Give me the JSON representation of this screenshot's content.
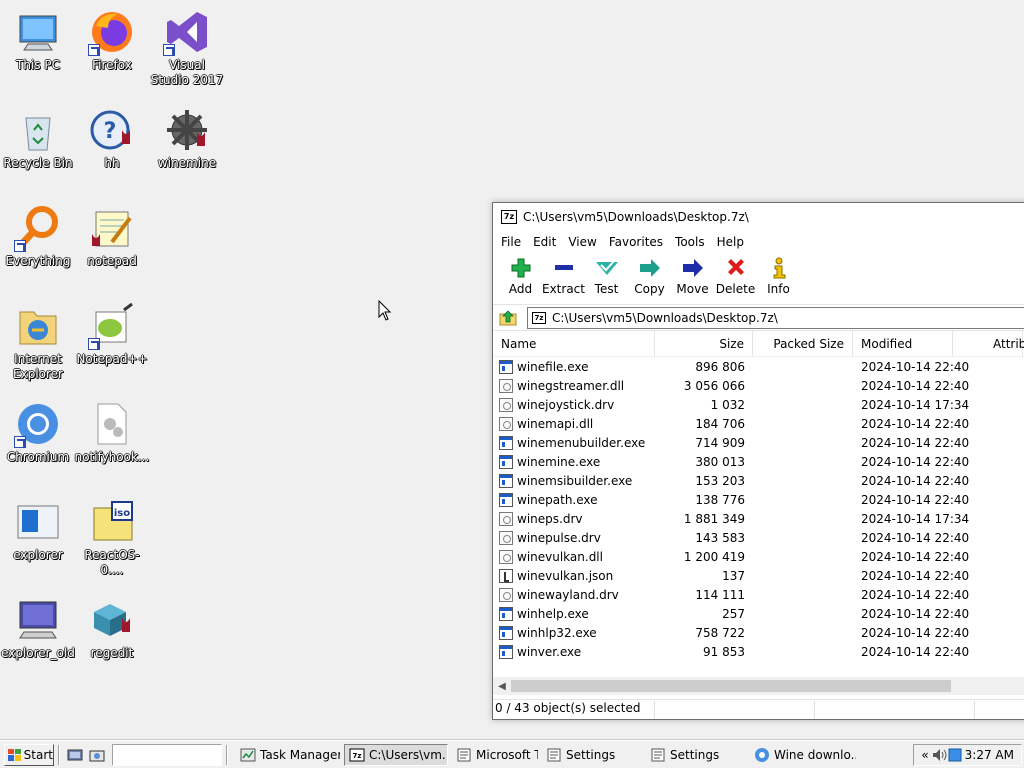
{
  "desktop": {
    "icons": [
      {
        "label": "This PC"
      },
      {
        "label": "Firefox"
      },
      {
        "label": "Visual Studio 2017"
      },
      {
        "label": "Recycle Bin"
      },
      {
        "label": "hh"
      },
      {
        "label": "winemine"
      },
      {
        "label": "Everything"
      },
      {
        "label": "notepad"
      },
      {
        "label": "Internet Explorer"
      },
      {
        "label": "Notepad++"
      },
      {
        "label": "Chromium"
      },
      {
        "label": "notifyhook..."
      },
      {
        "label": "explorer"
      },
      {
        "label": "ReactOS-0...."
      },
      {
        "label": "explorer_old"
      },
      {
        "label": "regedit"
      }
    ]
  },
  "window": {
    "title": "C:\\Users\\vm5\\Downloads\\Desktop.7z\\",
    "app_badge": "7z",
    "menu": [
      "File",
      "Edit",
      "View",
      "Favorites",
      "Tools",
      "Help"
    ],
    "toolbar": [
      "Add",
      "Extract",
      "Test",
      "Copy",
      "Move",
      "Delete",
      "Info"
    ],
    "address": "C:\\Users\\vm5\\Downloads\\Desktop.7z\\",
    "columns": [
      "Name",
      "Size",
      "Packed Size",
      "Modified",
      "Attrib"
    ],
    "files": [
      {
        "name": "winefile.exe",
        "size": "896 806",
        "modified": "2024-10-14 22:40",
        "kind": "exe"
      },
      {
        "name": "winegstreamer.dll",
        "size": "3 056 066",
        "modified": "2024-10-14 22:40",
        "kind": "dll"
      },
      {
        "name": "winejoystick.drv",
        "size": "1 032",
        "modified": "2024-10-14 17:34",
        "kind": "dll"
      },
      {
        "name": "winemapi.dll",
        "size": "184 706",
        "modified": "2024-10-14 22:40",
        "kind": "dll"
      },
      {
        "name": "winemenubuilder.exe",
        "size": "714 909",
        "modified": "2024-10-14 22:40",
        "kind": "exe"
      },
      {
        "name": "winemine.exe",
        "size": "380 013",
        "modified": "2024-10-14 22:40",
        "kind": "exe"
      },
      {
        "name": "winemsibuilder.exe",
        "size": "153 203",
        "modified": "2024-10-14 22:40",
        "kind": "exe"
      },
      {
        "name": "winepath.exe",
        "size": "138 776",
        "modified": "2024-10-14 22:40",
        "kind": "exe"
      },
      {
        "name": "wineps.drv",
        "size": "1 881 349",
        "modified": "2024-10-14 17:34",
        "kind": "dll"
      },
      {
        "name": "winepulse.drv",
        "size": "143 583",
        "modified": "2024-10-14 22:40",
        "kind": "dll"
      },
      {
        "name": "winevulkan.dll",
        "size": "1 200 419",
        "modified": "2024-10-14 22:40",
        "kind": "dll"
      },
      {
        "name": "winevulkan.json",
        "size": "137",
        "modified": "2024-10-14 22:40",
        "kind": "json"
      },
      {
        "name": "winewayland.drv",
        "size": "114 111",
        "modified": "2024-10-14 22:40",
        "kind": "dll"
      },
      {
        "name": "winhelp.exe",
        "size": "257",
        "modified": "2024-10-14 22:40",
        "kind": "exe"
      },
      {
        "name": "winhlp32.exe",
        "size": "758 722",
        "modified": "2024-10-14 22:40",
        "kind": "exe"
      },
      {
        "name": "winver.exe",
        "size": "91 853",
        "modified": "2024-10-14 22:40",
        "kind": "exe"
      }
    ],
    "status": "0 / 43 object(s) selected"
  },
  "taskbar": {
    "start_label": "Start",
    "tasks": [
      {
        "label": "Task Manager",
        "active": false
      },
      {
        "label": "C:\\Users\\vm...",
        "active": true
      },
      {
        "label": "Microsoft Tex...",
        "active": false
      },
      {
        "label": "Settings",
        "active": false
      },
      {
        "label": "Settings",
        "active": false
      },
      {
        "label": "Wine downlo...",
        "active": false
      }
    ],
    "tray_expand": "«",
    "clock": "3:27 AM"
  }
}
